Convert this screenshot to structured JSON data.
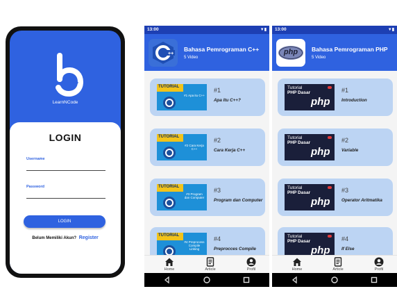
{
  "login": {
    "brand": "LearnNCode",
    "title": "LOGIN",
    "username_label": "Username",
    "password_label": "Password",
    "button_label": "LOGIN",
    "register_prompt": "Belum Memiliki Akun?",
    "register_link": "Register"
  },
  "cpp": {
    "status_time": "13:00",
    "title": "Bahasa Pemrograman C++",
    "count": "5 Video",
    "thumb_label": "TUTORIAL",
    "items": [
      {
        "num": "#1",
        "title": "Apa Itu C++?",
        "thumb_sub": "#1 Apa itu C++"
      },
      {
        "num": "#2",
        "title": "Cara Kerja C++",
        "thumb_sub": "#2 Cara Kerja C++"
      },
      {
        "num": "#3",
        "title": "Program dan Computer",
        "thumb_sub": "#3 Program dan Computer"
      },
      {
        "num": "#4",
        "title": "Preprocces Compile",
        "thumb_sub": "#4 Preprocess Compile Linking"
      }
    ]
  },
  "php": {
    "status_time": "13:00",
    "logo_text": "php",
    "title": "Bahasa Pemrograman PHP",
    "count": "5 Video",
    "thumb_line1": "Tutorial",
    "thumb_line2": "PHP Dasar",
    "thumb_big": "php",
    "items": [
      {
        "num": "#1",
        "title": "Introduction"
      },
      {
        "num": "#2",
        "title": "Variable"
      },
      {
        "num": "#3",
        "title": "Operator Aritmatika"
      },
      {
        "num": "#4",
        "title": "If Else"
      }
    ]
  },
  "nav": {
    "home": "Home",
    "article": "Article",
    "profil": "Profil"
  },
  "colors": {
    "primary": "#2f62e0",
    "statusbar": "#1d3fb3",
    "card": "#bcd4f3"
  }
}
